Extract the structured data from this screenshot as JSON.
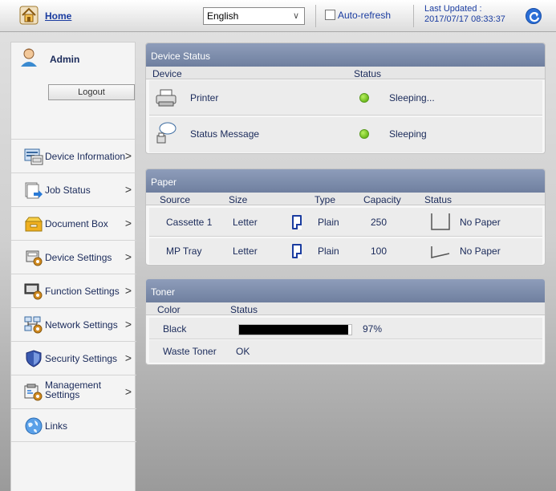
{
  "topbar": {
    "home_label": "Home",
    "language": "English",
    "auto_refresh_label": "Auto-refresh",
    "last_updated_label": "Last Updated :",
    "last_updated_value": "2017/07/17 08:33:37"
  },
  "sidebar": {
    "user": "Admin",
    "logout_label": "Logout",
    "items": [
      {
        "label": "Device Information",
        "icon": "device-information-icon"
      },
      {
        "label": "Job Status",
        "icon": "job-status-icon"
      },
      {
        "label": "Document Box",
        "icon": "document-box-icon"
      },
      {
        "label": "Device Settings",
        "icon": "device-settings-icon"
      },
      {
        "label": "Function Settings",
        "icon": "function-settings-icon"
      },
      {
        "label": "Network Settings",
        "icon": "network-settings-icon"
      },
      {
        "label": "Security Settings",
        "icon": "security-settings-icon"
      },
      {
        "label": "Management Settings",
        "label_line1": "Management",
        "label_line2": "Settings",
        "icon": "management-settings-icon"
      },
      {
        "label": "Links",
        "icon": "links-icon"
      }
    ]
  },
  "device_status": {
    "title": "Device Status",
    "headers": {
      "device": "Device",
      "status": "Status"
    },
    "rows": [
      {
        "device": "Printer",
        "status": "Sleeping...",
        "indicator": "green"
      },
      {
        "device": "Status Message",
        "status": "Sleeping",
        "indicator": "green"
      }
    ]
  },
  "paper": {
    "title": "Paper",
    "headers": {
      "source": "Source",
      "size": "Size",
      "type": "Type",
      "capacity": "Capacity",
      "status": "Status"
    },
    "rows": [
      {
        "source": "Cassette 1",
        "size": "Letter",
        "type": "Plain",
        "capacity": "250",
        "status": "No Paper"
      },
      {
        "source": "MP Tray",
        "size": "Letter",
        "type": "Plain",
        "capacity": "100",
        "status": "No Paper"
      }
    ]
  },
  "toner": {
    "title": "Toner",
    "headers": {
      "color": "Color",
      "status": "Status"
    },
    "rows": [
      {
        "color": "Black",
        "percent_text": "97%",
        "level": 0.97
      },
      {
        "color": "Waste Toner",
        "status": "OK"
      }
    ]
  },
  "colors": {
    "header_bg": "#7f8fae",
    "link_blue": "#1a3ca0",
    "status_green": "#4ea400"
  }
}
